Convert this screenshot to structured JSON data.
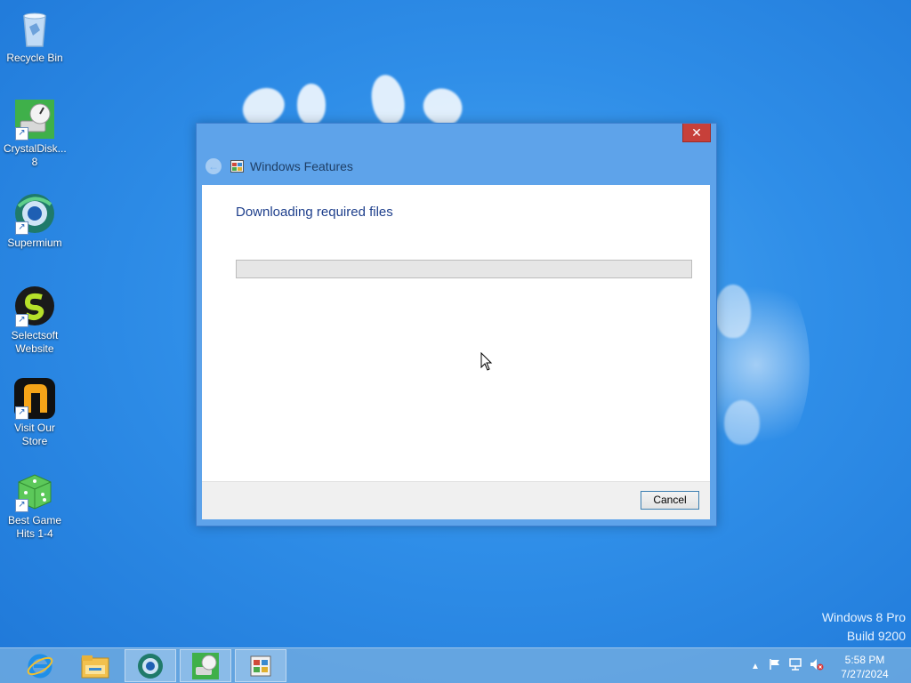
{
  "desktop": {
    "icons": [
      {
        "label": "Recycle Bin"
      },
      {
        "label": "CrystalDisk...\n8"
      },
      {
        "label": "Supermium"
      },
      {
        "label": "Selectsoft\nWebsite"
      },
      {
        "label": "Visit Our\nStore"
      },
      {
        "label": "Best Game\nHits 1-4"
      }
    ]
  },
  "dialog": {
    "title": "Windows Features",
    "close_glyph": "✕",
    "back_glyph": "←",
    "heading": "Downloading required files",
    "progress_fraction": 0,
    "cancel_label": "Cancel"
  },
  "watermark": {
    "line1": "Windows 8 Pro",
    "line2": "Build 9200"
  },
  "taskbar": {
    "buttons": [
      {
        "name": "internet-explorer-icon"
      },
      {
        "name": "file-explorer-icon"
      },
      {
        "name": "supermium-icon"
      },
      {
        "name": "crystaldisk-icon"
      },
      {
        "name": "windows-features-icon"
      }
    ],
    "clock": {
      "time": "5:58 PM",
      "date": "7/27/2024"
    }
  },
  "colors": {
    "accent": "#5ea3ea",
    "heading": "#1e3f8c",
    "close": "#c7403a"
  }
}
